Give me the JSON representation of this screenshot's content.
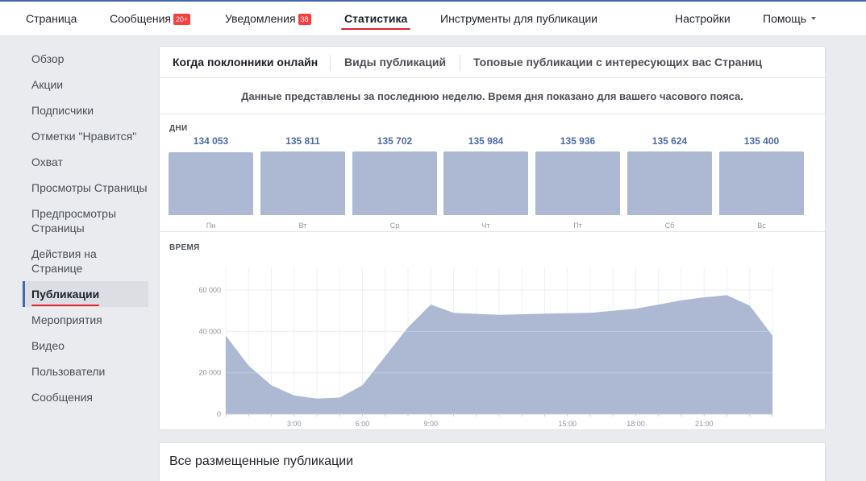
{
  "top_nav": {
    "items": [
      {
        "label": "Страница",
        "badge": ""
      },
      {
        "label": "Сообщения",
        "badge": "20+"
      },
      {
        "label": "Уведомления",
        "badge": "38"
      },
      {
        "label": "Статистика",
        "badge": ""
      },
      {
        "label": "Инструменты для публикации",
        "badge": ""
      }
    ],
    "settings_label": "Настройки",
    "help_label": "Помощь",
    "active_item": "Статистика"
  },
  "sidebar": {
    "items": [
      {
        "label": "Обзор"
      },
      {
        "label": "Акции"
      },
      {
        "label": "Подписчики"
      },
      {
        "label": "Отметки \"Нравится\""
      },
      {
        "label": "Охват"
      },
      {
        "label": "Просмотры Страницы"
      },
      {
        "label": "Предпросмотры Страницы"
      },
      {
        "label": "Действия на Странице"
      },
      {
        "label": "Публикации"
      },
      {
        "label": "Мероприятия"
      },
      {
        "label": "Видео"
      },
      {
        "label": "Пользователи"
      },
      {
        "label": "Сообщения"
      }
    ],
    "active_item": "Публикации"
  },
  "tabs": [
    {
      "label": "Когда поклонники онлайн"
    },
    {
      "label": "Виды публикаций"
    },
    {
      "label": "Топовые публикации с интересующих вас Страниц"
    }
  ],
  "notice": "Данные представлены за последнюю неделю. Время дня показано для вашего часового пояса.",
  "days_section": {
    "title": "ДНИ",
    "days": [
      {
        "label": "Пн",
        "value": "134 053"
      },
      {
        "label": "Вт",
        "value": "135 811"
      },
      {
        "label": "Ср",
        "value": "135 702"
      },
      {
        "label": "Чт",
        "value": "135 984"
      },
      {
        "label": "Пт",
        "value": "135 936"
      },
      {
        "label": "Сб",
        "value": "135 624"
      },
      {
        "label": "Вс",
        "value": "135 400"
      }
    ]
  },
  "time_section": {
    "title": "ВРЕМЯ"
  },
  "chart_data": [
    {
      "type": "bar",
      "title": "ДНИ",
      "categories": [
        "Пн",
        "Вт",
        "Ср",
        "Чт",
        "Пт",
        "Сб",
        "Вс"
      ],
      "values": [
        134053,
        135811,
        135702,
        135984,
        135936,
        135624,
        135400
      ],
      "ylim": [
        0,
        135984
      ]
    },
    {
      "type": "area",
      "title": "ВРЕМЯ",
      "x": [
        0,
        1,
        2,
        3,
        4,
        5,
        6,
        7,
        8,
        9,
        10,
        11,
        12,
        13,
        14,
        15,
        16,
        17,
        18,
        19,
        20,
        21,
        22,
        23,
        24
      ],
      "values": [
        38000,
        23500,
        14000,
        9000,
        7500,
        8000,
        14000,
        28000,
        42000,
        53000,
        49000,
        48500,
        48000,
        48300,
        48600,
        48800,
        49000,
        50000,
        51000,
        53000,
        55000,
        56500,
        57500,
        52500,
        38000
      ],
      "ylim": [
        0,
        60000
      ],
      "yticks": [
        "0",
        "20 000",
        "40 000",
        "60 000"
      ],
      "ytick_values": [
        0,
        20000,
        40000,
        60000
      ],
      "xticks": [
        "3:00",
        "6:00",
        "9:00",
        "15:00",
        "18:00",
        "21:00"
      ],
      "xtick_values": [
        3,
        6,
        9,
        15,
        18,
        21
      ],
      "grid": true,
      "color": "#adb9d3"
    }
  ],
  "bottom_panel": {
    "title": "Все размещенные публикации"
  },
  "colors": {
    "accent": "#4267b2",
    "active_underline": "#e0232f",
    "badge": "#fa3e3e",
    "bar_fill": "#adb9d3",
    "value_text": "#4b6aa4"
  }
}
